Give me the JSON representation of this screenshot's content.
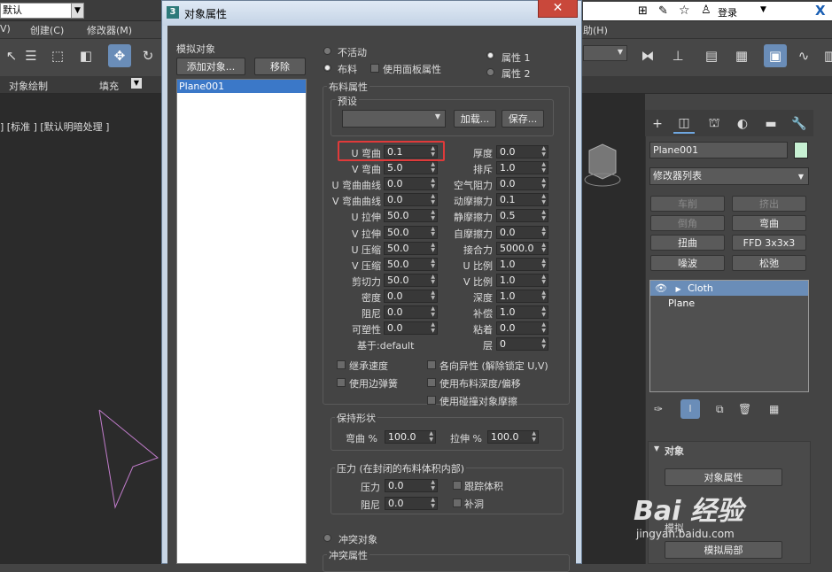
{
  "app": {
    "preset": "默认",
    "browser_login": "登录",
    "menu": [
      "V)",
      "创建(C)",
      "修改器(M)",
      "助(H)"
    ],
    "ribbon": [
      "对象绘制",
      "填充"
    ],
    "viewport_label": "] [标准 ] [默认明暗处理 ]"
  },
  "dialog": {
    "title": "对象属性",
    "icon_text": "3",
    "sim_objects_label": "模拟对象",
    "add_btn": "添加对象...",
    "remove_btn": "移除",
    "list_item": "Plane001",
    "radio_inactive": "不活动",
    "radio_cloth": "布料",
    "use_panel_props": "使用面板属性",
    "prop1": "属性 1",
    "prop2": "属性 2",
    "cloth_props": "布料属性",
    "preset_label": "预设",
    "load_btn": "加载...",
    "save_btn": "保存...",
    "left_fields": [
      {
        "label": "U 弯曲",
        "value": "0.1"
      },
      {
        "label": "V 弯曲",
        "value": "5.0"
      },
      {
        "label": "U 弯曲曲线",
        "value": "0.0"
      },
      {
        "label": "V 弯曲曲线",
        "value": "0.0"
      },
      {
        "label": "U 拉伸",
        "value": "50.0"
      },
      {
        "label": "V 拉伸",
        "value": "50.0"
      },
      {
        "label": "U 压缩",
        "value": "50.0"
      },
      {
        "label": "V 压缩",
        "value": "50.0"
      },
      {
        "label": "剪切力",
        "value": "50.0"
      },
      {
        "label": "密度",
        "value": "0.0"
      },
      {
        "label": "阻尼",
        "value": "0.0"
      },
      {
        "label": "可塑性",
        "value": "0.0"
      }
    ],
    "base_label": "基于:default",
    "right_fields": [
      {
        "label": "厚度",
        "value": "0.0"
      },
      {
        "label": "排斥",
        "value": "1.0"
      },
      {
        "label": "空气阻力",
        "value": "0.0"
      },
      {
        "label": "动摩擦力",
        "value": "0.1"
      },
      {
        "label": "静摩擦力",
        "value": "0.5"
      },
      {
        "label": "自摩擦力",
        "value": "0.0"
      },
      {
        "label": "接合力",
        "value": "5000.0"
      },
      {
        "label": "U 比例",
        "value": "1.0"
      },
      {
        "label": "V 比例",
        "value": "1.0"
      },
      {
        "label": "深度",
        "value": "1.0"
      },
      {
        "label": "补偿",
        "value": "1.0"
      },
      {
        "label": "粘着",
        "value": "0.0"
      },
      {
        "label": "层",
        "value": "0"
      }
    ],
    "checks": [
      "继承速度",
      "使用边弹簧",
      "各向异性 (解除锁定 U,V)",
      "使用布料深度/偏移",
      "使用碰撞对象摩擦"
    ],
    "keep_shape": "保持形状",
    "bend_pct_label": "弯曲 %",
    "bend_pct": "100.0",
    "stretch_pct_label": "拉伸 %",
    "stretch_pct": "100.0",
    "pressure_group": "压力 (在封闭的布料体积内部)",
    "pressure_label": "压力",
    "pressure": "0.0",
    "damping_label": "阻尼",
    "damping": "0.0",
    "track_volume": "跟踪体积",
    "cap_holes": "补洞",
    "collision_obj": "冲突对象",
    "collision_props": "冲突属性"
  },
  "panel": {
    "object_name": "Plane001",
    "modifier_list": "修改器列表",
    "buttons": [
      "车削",
      "挤出",
      "倒角",
      "弯曲",
      "扭曲",
      "FFD 3x3x3",
      "噪波",
      "松弛"
    ],
    "stack": [
      "Cloth",
      "Plane"
    ],
    "rollout_title": "对象",
    "rollout_btn1": "对象属性",
    "rollout_btn2": "模拟局部",
    "sim_label": "模拟"
  },
  "watermark": "Bai 经验",
  "watermark_url": "jingyan.baidu.com",
  "colors": {
    "highlight": "#e03a3a",
    "selection": "#3b78c8",
    "accent": "#6a8db8"
  }
}
